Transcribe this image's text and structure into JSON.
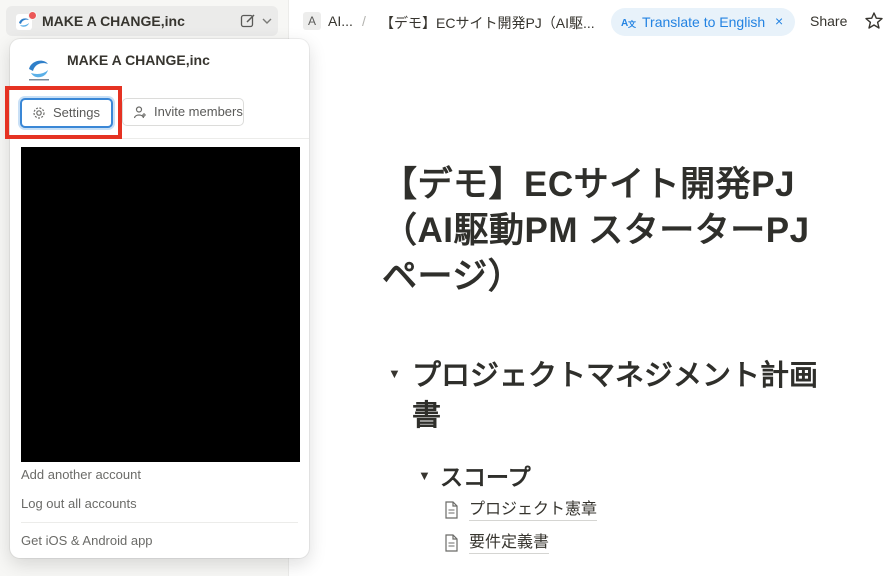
{
  "sidebar": {
    "workspace_name": "MAKE A CHANGE,inc"
  },
  "topbar": {
    "crumb_icon": "A",
    "crumb_1": "AI...",
    "separator": "/",
    "crumb_2": "【デモ】ECサイト開発PJ（AI駆...",
    "translate_label": "Translate to English",
    "translate_icon": "translate-icon",
    "close_glyph": "×",
    "share_label": "Share"
  },
  "page": {
    "title": "【デモ】ECサイト開発PJ（AI駆動PM スターターPJページ）",
    "heading1": "プロジェクトマネジメント計画書",
    "heading2": "スコープ",
    "toggle_glyph": "▼",
    "links": [
      "プロジェクト憲章",
      "要件定義書"
    ]
  },
  "popup": {
    "workspace_name": "MAKE A CHANGE,inc",
    "settings_label": "Settings",
    "invite_label": "Invite members",
    "add_account": "Add another account",
    "logout_all": "Log out all accounts",
    "get_app": "Get iOS & Android app"
  },
  "colors": {
    "accent_blue": "#2383e2",
    "highlight_red": "#e53222",
    "notification_dot": "#eb5757"
  }
}
